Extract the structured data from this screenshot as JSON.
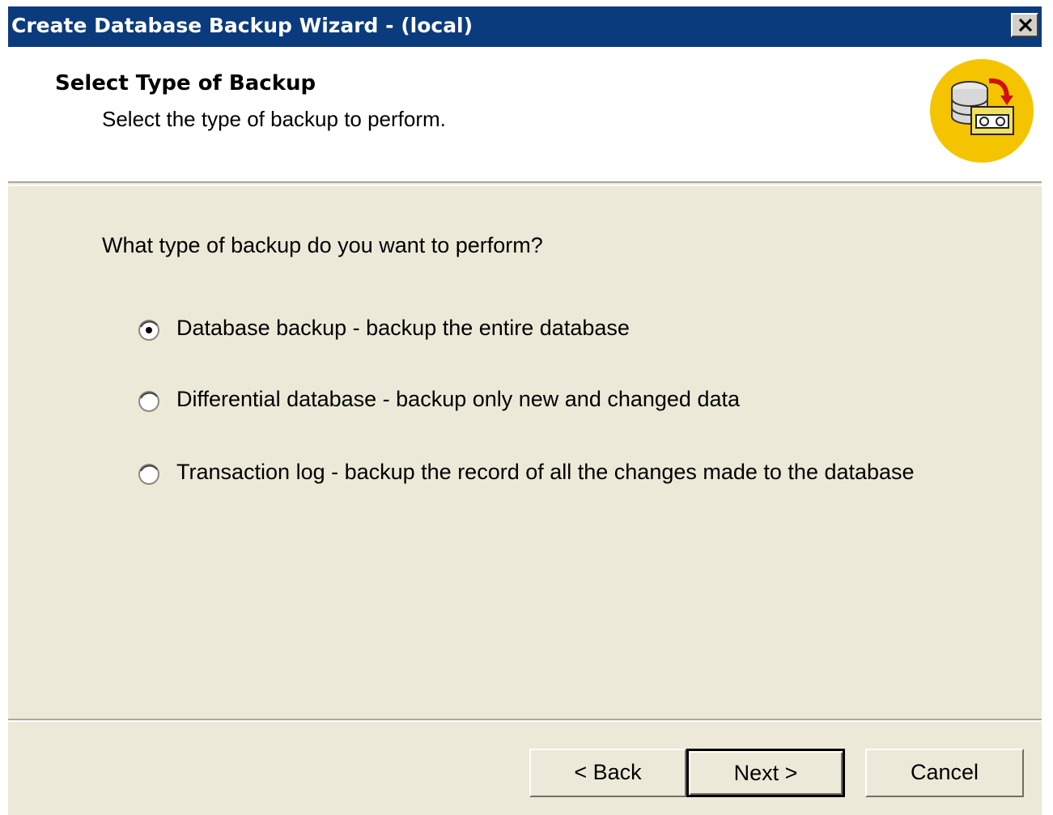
{
  "window": {
    "title": "Create Database Backup Wizard - (local)"
  },
  "header": {
    "title": "Select Type of Backup",
    "subtitle": "Select the type of backup to perform.",
    "icon": "database-backup-icon"
  },
  "main": {
    "question": "What type of backup do you want to perform?",
    "options": [
      {
        "label": "Database backup - backup the entire database",
        "selected": true
      },
      {
        "label": "Differential database - backup only new and changed data",
        "selected": false
      },
      {
        "label": "Transaction log - backup the record of all the changes made to the database",
        "selected": false
      }
    ]
  },
  "footer": {
    "back_label": "< Back",
    "next_label": "Next >",
    "cancel_label": "Cancel"
  },
  "colors": {
    "titlebar": "#0a3b7d",
    "dialog_background": "#ece9d8",
    "icon_accent": "#f5c400"
  }
}
